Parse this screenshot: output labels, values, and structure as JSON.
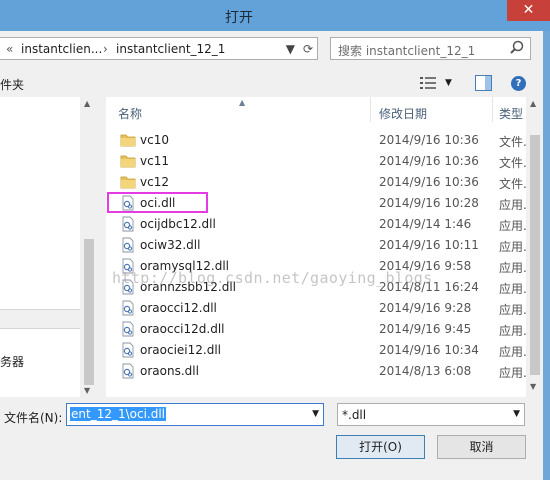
{
  "window": {
    "title": "打开",
    "close_glyph": "✕"
  },
  "address": {
    "chevrons": "«",
    "parent_crumb": "instantclien...",
    "separator": "›",
    "current_crumb": "instantclient_12_1"
  },
  "search": {
    "placeholder": "搜索 instantclient_12_1"
  },
  "toolbar": {
    "left_label": "件夹"
  },
  "nav": {
    "bottom_label": "务器"
  },
  "columns": {
    "name": "名称",
    "date": "修改日期",
    "type": "类型"
  },
  "files": [
    {
      "name": "vc10",
      "kind": "folder",
      "date": "2014/9/16 10:36",
      "type": "文件..."
    },
    {
      "name": "vc11",
      "kind": "folder",
      "date": "2014/9/16 10:36",
      "type": "文件..."
    },
    {
      "name": "vc12",
      "kind": "folder",
      "date": "2014/9/16 10:36",
      "type": "文件..."
    },
    {
      "name": "oci.dll",
      "kind": "dll",
      "date": "2014/9/16 10:28",
      "type": "应用..."
    },
    {
      "name": "ocijdbc12.dll",
      "kind": "dll",
      "date": "2014/9/14 1:46",
      "type": "应用..."
    },
    {
      "name": "ociw32.dll",
      "kind": "dll",
      "date": "2014/9/16 10:11",
      "type": "应用..."
    },
    {
      "name": "oramysql12.dll",
      "kind": "dll",
      "date": "2014/9/16 9:58",
      "type": "应用..."
    },
    {
      "name": "orannzsbb12.dll",
      "kind": "dll",
      "date": "2014/8/11 16:24",
      "type": "应用..."
    },
    {
      "name": "oraocci12.dll",
      "kind": "dll",
      "date": "2014/9/16 9:28",
      "type": "应用..."
    },
    {
      "name": "oraocci12d.dll",
      "kind": "dll",
      "date": "2014/9/16 9:45",
      "type": "应用..."
    },
    {
      "name": "oraociei12.dll",
      "kind": "dll",
      "date": "2014/9/16 10:34",
      "type": "应用..."
    },
    {
      "name": "oraons.dll",
      "kind": "dll",
      "date": "2014/8/13 6:08",
      "type": "应用..."
    }
  ],
  "watermark": "http://blog.csdn.net/gaoying_blogs",
  "filename": {
    "label": "文件名(N):",
    "value": "ent_12_1\\oci.dll"
  },
  "filter": {
    "value": "*.dll"
  },
  "buttons": {
    "open": "打开(O)",
    "cancel": "取消"
  },
  "colors": {
    "titlebar": "#62a2d9",
    "close": "#c7403a",
    "highlight": "#e43ce3",
    "selection": "#3399ff"
  }
}
